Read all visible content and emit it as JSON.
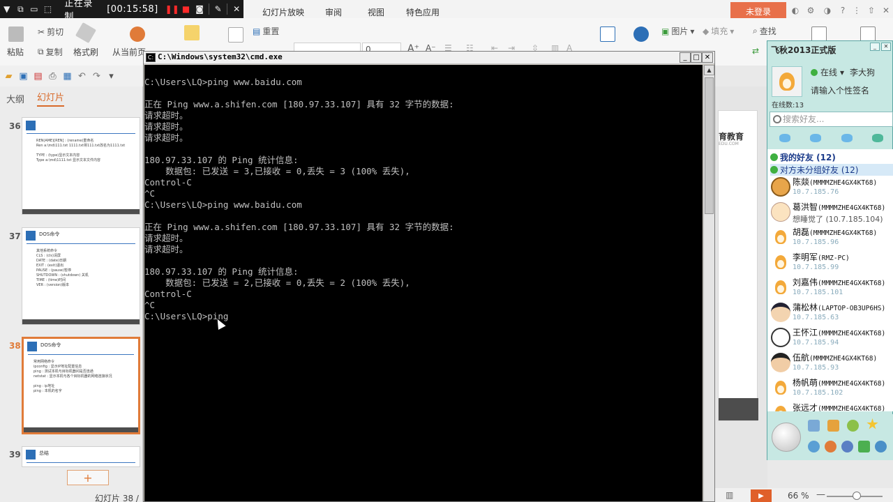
{
  "recorder": {
    "status": "正在录制",
    "time": "[00:15:58]"
  },
  "ribbon": {
    "tabs": [
      "幻灯片放映",
      "审阅",
      "视图",
      "特色应用"
    ],
    "login": "未登录",
    "cut": "剪切",
    "copy": "复制",
    "format_painter": "格式刷",
    "paste": "粘贴",
    "from_current": "从当前页",
    "reset": "重置",
    "font_size": "0",
    "picture": "图片",
    "fill": "填充",
    "find": "查找"
  },
  "left_panel": {
    "tab_outline": "大纲",
    "tab_slides": "幻灯片",
    "status": "幻灯片 38 /",
    "add_button": "+",
    "slides": [
      {
        "num": "36",
        "heading": "",
        "body": "REN(AME)[REN] : (rename)重命名\nRen a:\\md\\111.txt 1111.txt将111.txt改名为1111.txt\n\nTYPE : (type)显示文本内容\nType a:\\md\\1111.txt 显示文本文件内容"
      },
      {
        "num": "37",
        "heading": "DOS命令",
        "body": "其他系统命令\nCLS : (cls)清屏\nDATE : (date)日期\nEXIT : (exit)退出\nPAUSE : (pause)暂停\nSHUTDOWN : (shutdown) 关机\nTIME : (time)时间\nVER : (version)版本"
      },
      {
        "num": "38",
        "heading": "DOS命令",
        "body": "常用网络命令\nipconfig : 显示IP地址配置信息\nping : 测试本机与目标机器间是否连通\nnetstat : 显示本机与各个目标机器的网络连接状况\n\nping : ip地址\nping : 本机的名字"
      },
      {
        "num": "39",
        "heading": "总结",
        "body": ""
      }
    ]
  },
  "cmd": {
    "title": "C:\\Windows\\system32\\cmd.exe",
    "lines": [
      "C:\\Users\\LQ>ping www.baidu.com",
      "",
      "正在 Ping www.a.shifen.com [180.97.33.107] 具有 32 字节的数据:",
      "请求超时。",
      "请求超时。",
      "请求超时。",
      "",
      "180.97.33.107 的 Ping 统计信息:",
      "    数据包: 已发送 = 3,已接收 = 0,丢失 = 3 (100% 丢失),",
      "Control-C",
      "^C",
      "C:\\Users\\LQ>ping www.baidu.com",
      "",
      "正在 Ping www.a.shifen.com [180.97.33.107] 具有 32 字节的数据:",
      "请求超时。",
      "请求超时。",
      "",
      "180.97.33.107 的 Ping 统计信息:",
      "    数据包: 已发送 = 2,已接收 = 0,丢失 = 2 (100% 丢失),",
      "Control-C",
      "^C",
      "C:\\Users\\LQ>ping"
    ]
  },
  "slide_peek": {
    "brand": "育教育",
    "sub": "EDU.COM"
  },
  "status_bar": {
    "zoom": "66 %",
    "zoom_minus": "—"
  },
  "qq": {
    "title": "飞秋2013正式版",
    "status": "在线",
    "user": "李大狗",
    "signature": "请输入个性签名",
    "online_count": "在线数:13",
    "search_placeholder": "搜索好友...",
    "groups": {
      "my_friends": "我的好友 (12)",
      "ungrouped": "对方未分组好友 (12)"
    },
    "friends": [
      {
        "name": "陈燚",
        "host": "(MMMMZHE4GX4KT68)",
        "ip": "10.7.185.76",
        "avatar": "bear"
      },
      {
        "name": "葛洪智",
        "host": "(MMMMZHE4GX4KT68)",
        "ip": "想睡觉了 (10.7.185.104)",
        "avatar": "face"
      },
      {
        "name": "胡磊",
        "host": "(MMMMZHE4GX4KT68)",
        "ip": "10.7.185.96",
        "avatar": "penguin"
      },
      {
        "name": "李明军",
        "host": "(RMZ-PC)",
        "ip": "10.7.185.99",
        "avatar": "penguin"
      },
      {
        "name": "刘嘉伟",
        "host": "(MMMMZHE4GX4KT68)",
        "ip": "10.7.185.101",
        "avatar": "penguin"
      },
      {
        "name": "蒲松林",
        "host": "(LAPTOP-OB3UP6HS)",
        "ip": "10.7.185.63",
        "avatar": "grad"
      },
      {
        "name": "王怀江",
        "host": "(MMMMZHE4GX4KT68)",
        "ip": "10.7.185.94",
        "avatar": "dog"
      },
      {
        "name": "伍航",
        "host": "(MMMMZHE4GX4KT68)",
        "ip": "10.7.185.93",
        "avatar": "man"
      },
      {
        "name": "杨帆萌",
        "host": "(MMMMZHE4GX4KT68)",
        "ip": "10.7.185.102",
        "avatar": "penguin"
      },
      {
        "name": "张远才",
        "host": "(MMMMZHE4GX4KT68)",
        "ip": "",
        "avatar": "penguin"
      }
    ]
  },
  "colors": {
    "accent_orange": "#e07b39",
    "login_bg": "#e8704a",
    "qq_bg": "#c7e8e3",
    "cmd_bg": "#000000",
    "cmd_fg": "#c0c0c0"
  }
}
